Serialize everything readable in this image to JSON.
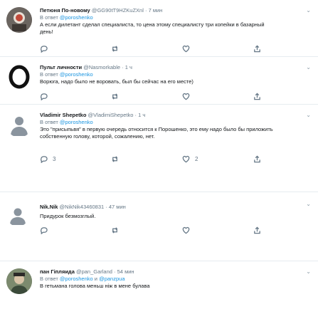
{
  "reply_prefix": "В ответ",
  "tweets": [
    {
      "name": "Петюня По-новому",
      "handle": "@GG90tT9HZKuZXnl",
      "time": "7 мин",
      "reply_to": [
        "@poroshenko"
      ],
      "text": "А если дилетант сделал специалиста, то цена этому специалисту три копейки в базарный день!",
      "counts": {
        "reply": "",
        "retweet": "",
        "like": ""
      }
    },
    {
      "name": "Пульт личности",
      "handle": "@Nasmorkable",
      "time": "1 ч",
      "reply_to": [
        "@poroshenko"
      ],
      "text": "Ворюга, надо было не воровать, был бы сейчас на его месте)",
      "counts": {
        "reply": "",
        "retweet": "",
        "like": ""
      }
    },
    {
      "name": "Vladimir Shepetko",
      "handle": "@VladimiShepetko",
      "time": "1 ч",
      "reply_to": [
        "@poroshenko"
      ],
      "text": "Это \"присыпьвя\" в первую очередь относится к Порошенко, это ему надо было бы приложить собственную голову, которой, сожалению, нет.",
      "counts": {
        "reply": "3",
        "retweet": "",
        "like": "2"
      }
    },
    {
      "name": "Nik.Nik",
      "handle": "@NikNik43460831",
      "time": "47 мин",
      "reply_to": [],
      "text": "Придурок безмозглый.",
      "counts": {
        "reply": "",
        "retweet": "",
        "like": ""
      }
    },
    {
      "name": "пан Гіпляида",
      "handle": "@pan_Garland",
      "time": "54 мин",
      "reply_to": [
        "@poroshenko",
        "@panzpua"
      ],
      "text": "В гетьмана голова меньш ніж в мене булава",
      "counts": {
        "reply": "",
        "retweet": "",
        "like": ""
      }
    }
  ],
  "colors": {
    "link": "#1b95e0",
    "muted": "#657786",
    "divider": "#e6ecf0"
  },
  "icons": {
    "reply": "reply-icon",
    "retweet": "retweet-icon",
    "like": "heart-icon",
    "share": "share-icon",
    "menu": "chevron-down-icon"
  }
}
